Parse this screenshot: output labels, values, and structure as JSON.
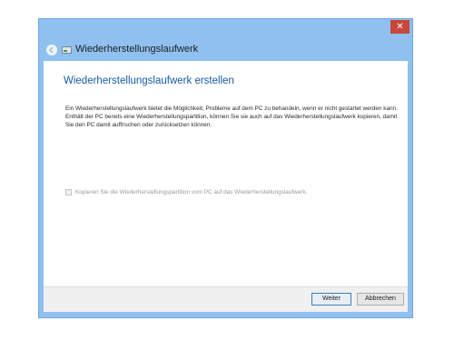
{
  "window": {
    "title": "Wiederherstellungslaufwerk",
    "close_label": "✕"
  },
  "content": {
    "heading": "Wiederherstellungslaufwerk erstellen",
    "description": "Ein Wiederherstellungslaufwerk bietet die Möglichkeit, Probleme auf dem PC zu behandeln, wenn er nicht gestartet werden kann. Enthält der PC bereits eine Wiederherstellungspartition, können Sie sie auch auf das Wiederherstellungslaufwerk kopieren, damit Sie den PC damit auffrischen oder zurücksetzen können.",
    "checkbox": {
      "label": "Kopieren Sie die Wiederherstellungspartition vom PC auf das Wiederherstellungslaufwerk.",
      "checked": false,
      "enabled": false
    }
  },
  "footer": {
    "next_label": "Weiter",
    "cancel_label": "Abbrechen"
  },
  "colors": {
    "accent": "#1a5aa8",
    "frame": "#8fc0f0",
    "close": "#c7473a"
  },
  "icons": [
    "back-arrow-icon",
    "drive-icon",
    "close-icon"
  ]
}
